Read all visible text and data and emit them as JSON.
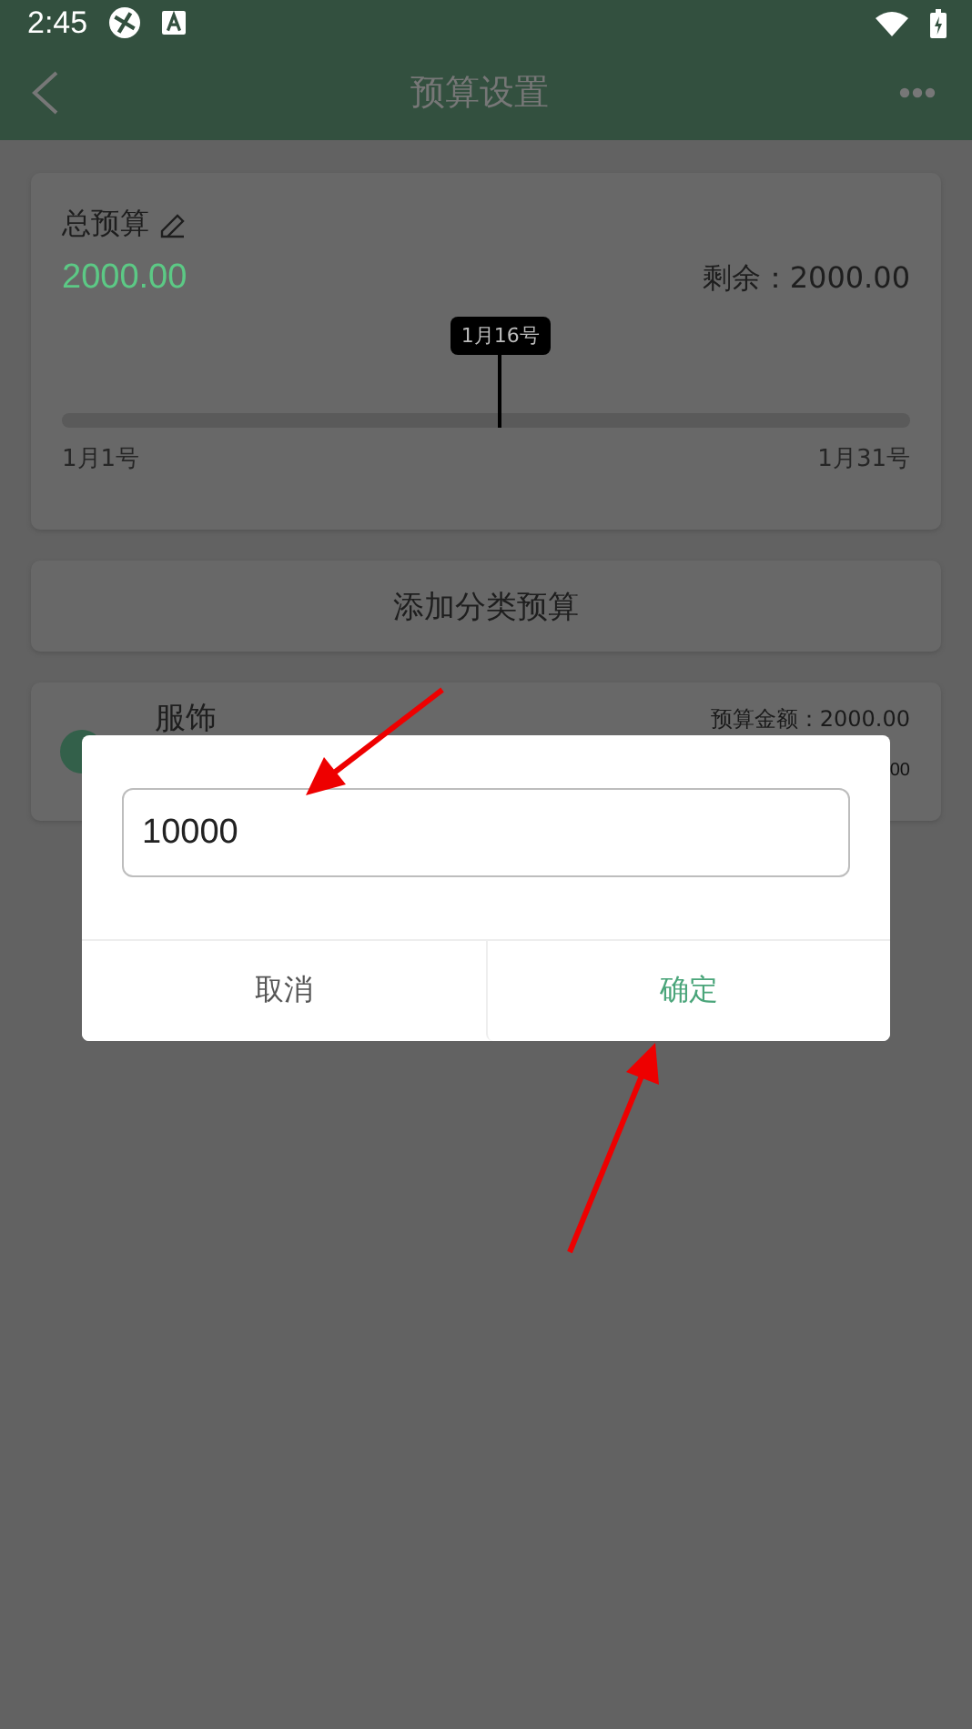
{
  "status_bar": {
    "time": "2:45"
  },
  "app_bar": {
    "title": "预算设置"
  },
  "total_budget": {
    "label": "总预算",
    "amount": "2000.00",
    "remaining": "剩余：2000.00",
    "marker": "1月16号",
    "level": 0.517,
    "start": "1月1号",
    "end": "1月31号"
  },
  "add_button": {
    "label": "添加分类预算"
  },
  "category": {
    "name": "服饰",
    "budget": "预算金额：2000.00",
    "line_2_visible": "00"
  },
  "dialog": {
    "value": "10000",
    "buttons": [
      {
        "label": "取消",
        "kind": "cancel"
      },
      {
        "label": "确定",
        "kind": "confirm"
      }
    ]
  }
}
